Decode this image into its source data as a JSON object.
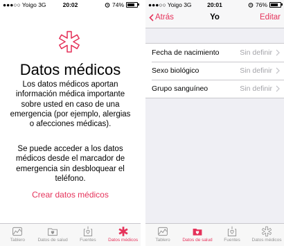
{
  "left_screen": {
    "statusbar": {
      "carrier": "●●●○○ Yoigo  3G",
      "time": "20:02",
      "battery": "74%",
      "battery_level": 0.74
    },
    "title": "Datos médicos",
    "paragraph1": "Los datos médicos aportan información médica importante sobre usted en caso de una emergencia (por ejemplo, alergias o afecciones médicas).",
    "paragraph2": "Se puede acceder a los datos médicos desde el marcador de emergencia sin desbloquear el teléfono.",
    "link": "Crear datos médicos",
    "tabs": [
      {
        "label": "Tablero",
        "icon": "chart-icon",
        "active": false
      },
      {
        "label": "Datos de salud",
        "icon": "folder-heart-icon",
        "active": false
      },
      {
        "label": "Fuentes",
        "icon": "download-heart-icon",
        "active": false
      },
      {
        "label": "Datos médicos",
        "icon": "medical-star-icon",
        "active": true
      }
    ]
  },
  "right_screen": {
    "statusbar": {
      "carrier": "●●●○○ Yoigo  3G",
      "time": "20:01",
      "battery": "76%",
      "battery_level": 0.76
    },
    "nav": {
      "back": "Atrás",
      "title": "Yo",
      "edit": "Editar"
    },
    "rows": [
      {
        "label": "Fecha de nacimiento",
        "value": "Sin definir"
      },
      {
        "label": "Sexo biológico",
        "value": "Sin definir"
      },
      {
        "label": "Grupo sanguíneo",
        "value": "Sin definir"
      }
    ],
    "tabs": [
      {
        "label": "Tablero",
        "icon": "chart-icon",
        "active": false
      },
      {
        "label": "Datos de salud",
        "icon": "folder-heart-icon",
        "active": true
      },
      {
        "label": "Fuentes",
        "icon": "download-heart-icon",
        "active": false
      },
      {
        "label": "Datos médicos",
        "icon": "medical-star-icon",
        "active": false
      }
    ]
  },
  "colors": {
    "accent": "#e5325a",
    "inactive": "#929292",
    "separator": "#c8c7cc",
    "grouped_bg": "#efeff4"
  }
}
